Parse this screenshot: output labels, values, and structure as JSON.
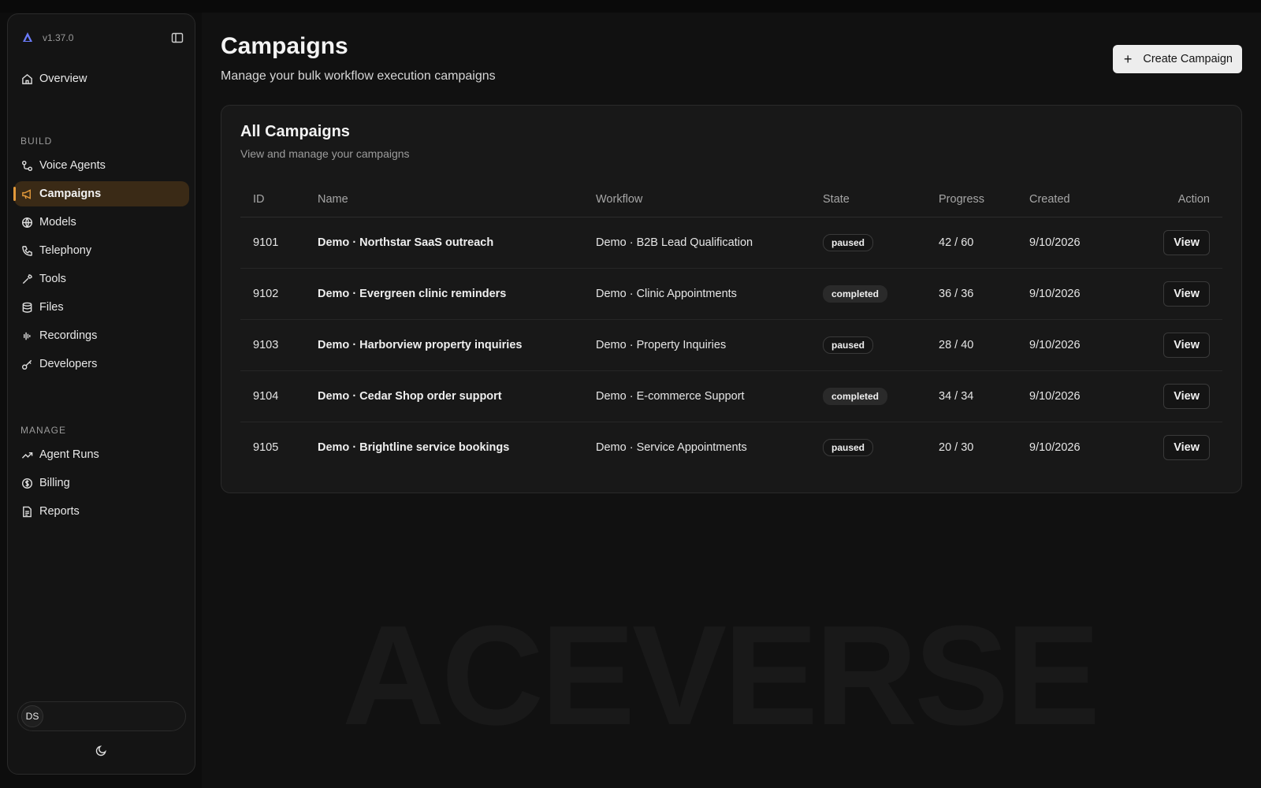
{
  "app": {
    "version": "v1.37.0",
    "watermark": "ACEVERSE",
    "accent": "#e39a3b"
  },
  "sidebar": {
    "top_items": [
      {
        "label": "Overview",
        "icon": "home-icon"
      }
    ],
    "build_label": "BUILD",
    "build_items": [
      {
        "label": "Voice Agents",
        "icon": "workflow-icon"
      },
      {
        "label": "Campaigns",
        "icon": "megaphone-icon",
        "active": true
      },
      {
        "label": "Models",
        "icon": "globe-icon"
      },
      {
        "label": "Telephony",
        "icon": "phone-icon"
      },
      {
        "label": "Tools",
        "icon": "wrench-icon"
      },
      {
        "label": "Files",
        "icon": "database-icon"
      },
      {
        "label": "Recordings",
        "icon": "audio-waveform-icon"
      },
      {
        "label": "Developers",
        "icon": "key-icon"
      }
    ],
    "manage_label": "MANAGE",
    "manage_items": [
      {
        "label": "Agent Runs",
        "icon": "trending-up-icon"
      },
      {
        "label": "Billing",
        "icon": "dollar-circle-icon"
      },
      {
        "label": "Reports",
        "icon": "file-text-icon"
      }
    ],
    "user": {
      "initials": "DS"
    }
  },
  "header": {
    "title": "Campaigns",
    "subtitle": "Manage your bulk workflow execution campaigns",
    "create_label": "Create Campaign"
  },
  "card": {
    "title": "All Campaigns",
    "subtitle": "View and manage your campaigns",
    "columns": {
      "id": "ID",
      "name": "Name",
      "workflow": "Workflow",
      "state": "State",
      "progress": "Progress",
      "created": "Created",
      "action": "Action"
    },
    "rows": [
      {
        "id": "9101",
        "name": "Demo · Northstar SaaS outreach",
        "workflow": "Demo · B2B Lead Qualification",
        "state": "paused",
        "progress": "42 / 60",
        "created": "9/10/2026",
        "action": "View"
      },
      {
        "id": "9102",
        "name": "Demo · Evergreen clinic reminders",
        "workflow": "Demo · Clinic Appointments",
        "state": "completed",
        "progress": "36 / 36",
        "created": "9/10/2026",
        "action": "View"
      },
      {
        "id": "9103",
        "name": "Demo · Harborview property inquiries",
        "workflow": "Demo · Property Inquiries",
        "state": "paused",
        "progress": "28 / 40",
        "created": "9/10/2026",
        "action": "View"
      },
      {
        "id": "9104",
        "name": "Demo · Cedar Shop order support",
        "workflow": "Demo · E-commerce Support",
        "state": "completed",
        "progress": "34 / 34",
        "created": "9/10/2026",
        "action": "View"
      },
      {
        "id": "9105",
        "name": "Demo · Brightline service bookings",
        "workflow": "Demo · Service Appointments",
        "state": "paused",
        "progress": "20 / 30",
        "created": "9/10/2026",
        "action": "View"
      }
    ]
  }
}
